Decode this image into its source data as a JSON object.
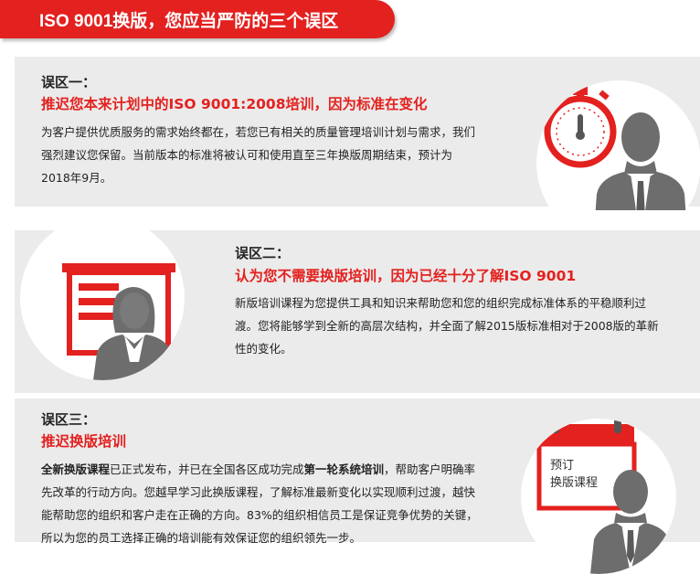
{
  "banner": {
    "title": "ISO 9001换版，您应当严防的三个误区"
  },
  "sections": [
    {
      "label": "误区一：",
      "heading": "推迟您本来计划中的ISO 9001:2008培训，因为标准在变化",
      "para_lines": [
        "为客户提供优质服务的需求始终都在，若您已有相关的质量管理培训计划与需求，我们",
        "强烈建议您保留。当前版本的标准将被认可和使用直至三年换版周期结束，预计为",
        "2018年9月。"
      ]
    },
    {
      "label": "误区二：",
      "heading": "认为您不需要换版培训，因为已经十分了解ISO 9001",
      "para_lines": [
        "新版培训课程为您提供工具和知识来帮助您和您的组织完成标准体系的平稳顺利过",
        "渡。您将能够学到全新的高层次结构，并全面了解2015版标准相对于2008版的革新",
        "性的变化。"
      ]
    },
    {
      "label": "误区三：",
      "heading": "推迟换版培训",
      "para": {
        "l1_b1": "全新换版课程",
        "l1_t1": "已正式发布，并已在全国各区成功完成",
        "l1_b2": "第一轮系统培训",
        "l1_t2": "，帮助客户明确率",
        "l2": "先改革的行动方向。您越早学习此换版课程，了解标准最新变化以实现顺利过渡，越快",
        "l3": "能帮助您的组织和客户走在正确的方向。83%的组织相信员工是保证竞争优势的关键，",
        "l4": "所以为您的员工选择正确的培训能有效保证您的组织领先一步。"
      },
      "calendar_text_1": "预订",
      "calendar_text_2": "换版课程"
    }
  ],
  "colors": {
    "accent": "#e3211f",
    "panel": "#ebebeb",
    "figure": "#6d6d6d"
  }
}
